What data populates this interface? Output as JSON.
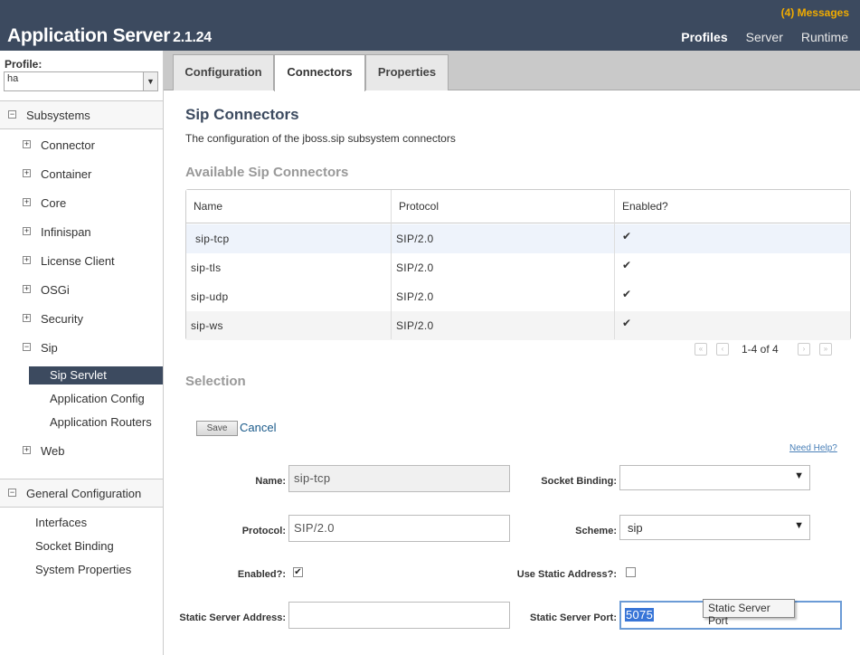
{
  "header": {
    "app_name": "Application Server",
    "version": "2.1.24",
    "messages": "(4) Messages",
    "nav": [
      "Profiles",
      "Server",
      "Runtime"
    ]
  },
  "sidebar": {
    "profile_label": "Profile:",
    "profile_value": "ha",
    "subsystems_label": "Subsystems",
    "tree": [
      "Connector",
      "Container",
      "Core",
      "Infinispan",
      "License Client",
      "OSGi",
      "Security",
      "Sip"
    ],
    "sip_children": [
      "Sip Servlet",
      "Application Config",
      "Application Routers"
    ],
    "web": "Web",
    "general_label": "General Configuration",
    "general_items": [
      "Interfaces",
      "Socket Binding",
      "System Properties"
    ]
  },
  "tabs": [
    "Configuration",
    "Connectors",
    "Properties"
  ],
  "main": {
    "title": "Sip Connectors",
    "description": "The configuration of the jboss.sip subsystem connectors",
    "available_title": "Available Sip Connectors",
    "columns": [
      "Name",
      "Protocol",
      "Enabled?"
    ],
    "rows": [
      {
        "name": "sip-tcp",
        "protocol": "SIP/2.0",
        "enabled": "✔"
      },
      {
        "name": "sip-tls",
        "protocol": "SIP/2.0",
        "enabled": "✔"
      },
      {
        "name": "sip-udp",
        "protocol": "SIP/2.0",
        "enabled": "✔"
      },
      {
        "name": "sip-ws",
        "protocol": "SIP/2.0",
        "enabled": "✔"
      }
    ],
    "pager_text": "1-4 of 4",
    "selection_title": "Selection",
    "save_label": "Save",
    "cancel_label": "Cancel",
    "help_label": "Need Help?"
  },
  "form": {
    "name_label": "Name:",
    "name_value": "sip-tcp",
    "protocol_label": "Protocol:",
    "protocol_value": "SIP/2.0",
    "enabled_label": "Enabled?:",
    "enabled_mark": "✔",
    "static_addr_label": "Static Server Address:",
    "static_addr_value": "",
    "socket_label": "Socket Binding:",
    "socket_value": "",
    "scheme_label": "Scheme:",
    "scheme_value": "sip",
    "use_static_label": "Use Static Address?:",
    "port_label": "Static Server Port:",
    "port_value": "5075",
    "tooltip": "Static Server Port"
  }
}
